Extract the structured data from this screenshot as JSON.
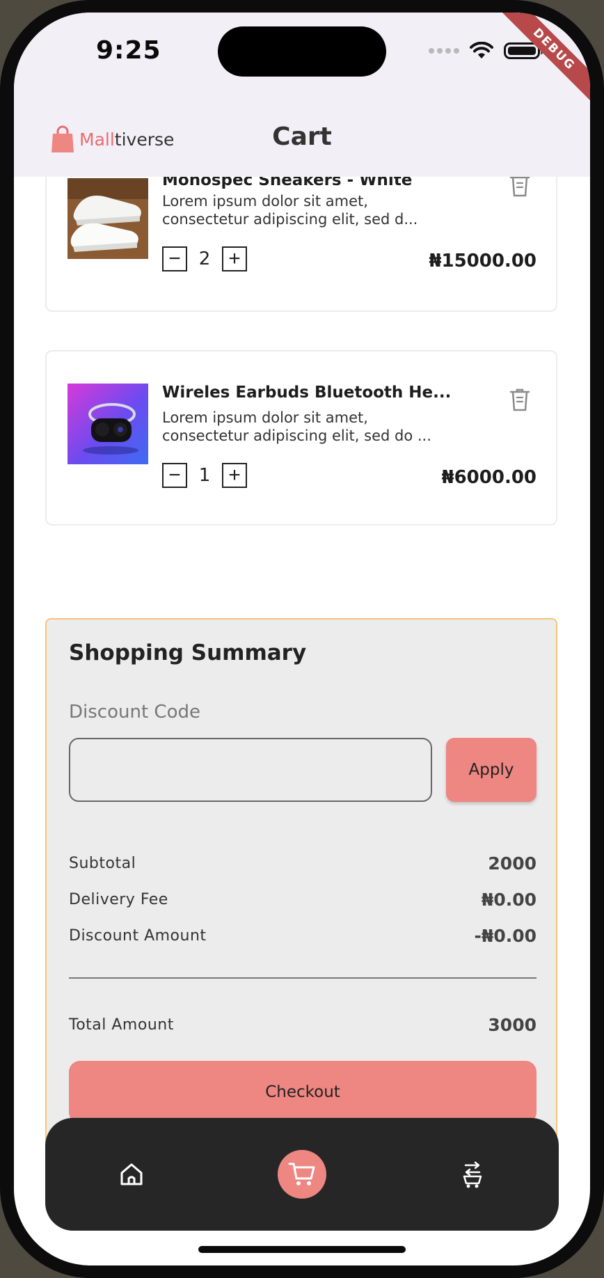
{
  "status_bar": {
    "time": "9:25",
    "debug_label": "DEBUG"
  },
  "app_bar": {
    "brand_accent": "Mall",
    "brand_rest": "tiverse",
    "title": "Cart"
  },
  "cart": {
    "items": [
      {
        "name": "Monospec Sneakers - White",
        "description": "Lorem ipsum dolor sit amet, consectetur adipiscing elit, sed d...",
        "quantity": "2",
        "price": "₦15000.00",
        "decrement": "−",
        "increment": "+"
      },
      {
        "name": "Wireles Earbuds Bluetooth He...",
        "description": "Lorem ipsum dolor sit amet, consectetur adipiscing elit, sed do ...",
        "quantity": "1",
        "price": "₦6000.00",
        "decrement": "−",
        "increment": "+"
      }
    ]
  },
  "summary": {
    "title": "Shopping Summary",
    "discount_label": "Discount Code",
    "discount_value": "",
    "apply_label": "Apply",
    "subtotal_label": "Subtotal",
    "subtotal_value": "2000",
    "delivery_label": "Delivery Fee",
    "delivery_value": "₦0.00",
    "discount_amount_label": "Discount Amount",
    "discount_amount_value": "-₦0.00",
    "total_label": "Total Amount",
    "total_value": "3000",
    "checkout_label": "Checkout"
  },
  "bottom_nav": {
    "items": [
      {
        "icon": "home-icon",
        "active": false
      },
      {
        "icon": "cart-icon",
        "active": true
      },
      {
        "icon": "orders-icon",
        "active": false
      }
    ]
  },
  "colors": {
    "accent": "#ee8681",
    "brand_accent": "#e86d6d",
    "summary_border": "#f6c57c",
    "nav_background": "#262626",
    "app_bar_background": "#f3eff7"
  }
}
